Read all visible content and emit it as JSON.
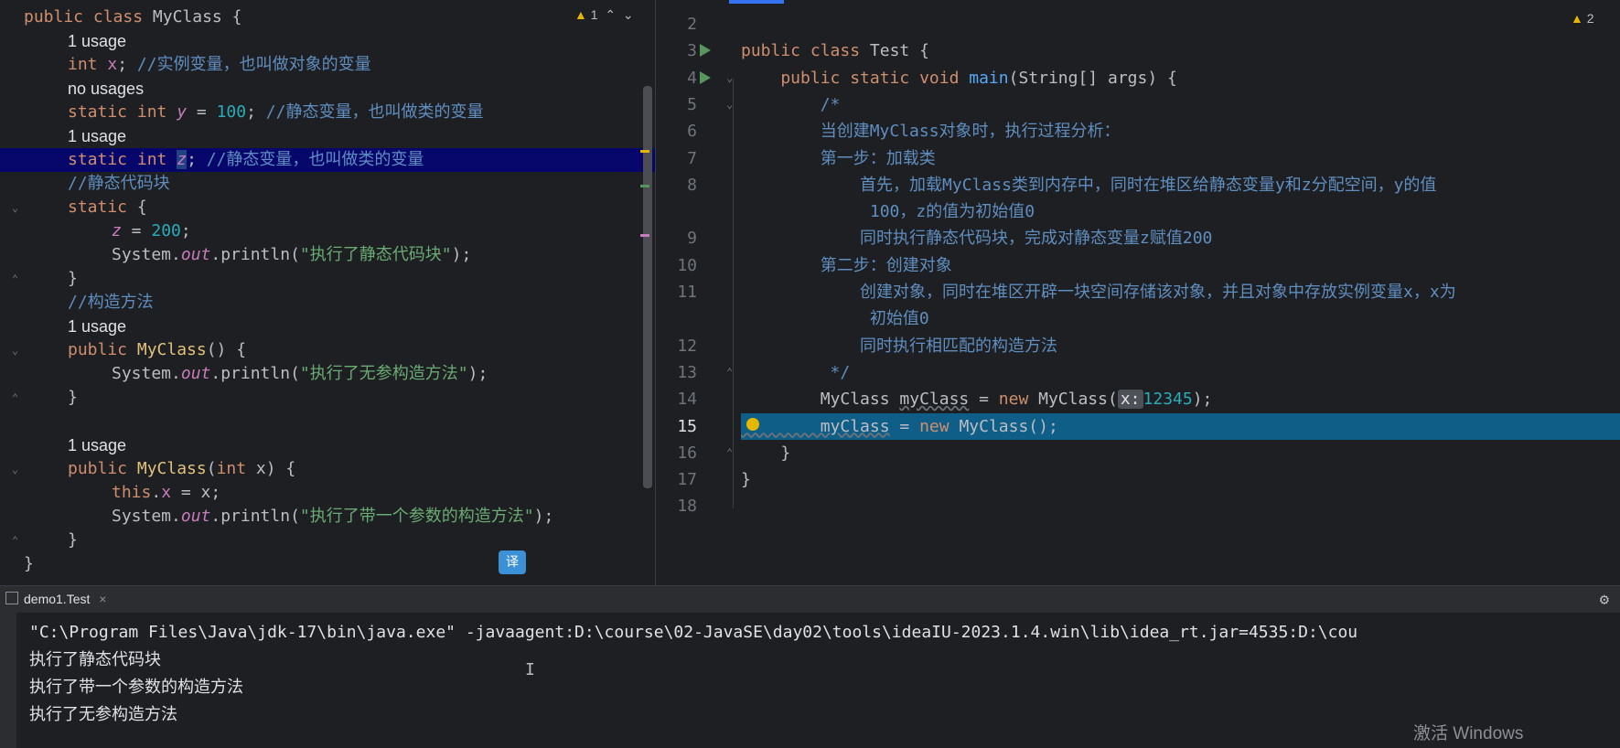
{
  "left_editor": {
    "inspection": {
      "count": "1"
    },
    "lines": [
      {
        "parts": [
          {
            "c": "kw",
            "t": "public class "
          },
          {
            "c": "plain",
            "t": "MyClass {"
          }
        ]
      },
      {
        "inlay": "1 usage"
      },
      {
        "parts": [
          {
            "c": "kw",
            "t": "int "
          },
          {
            "c": "field",
            "t": "x"
          },
          {
            "c": "plain",
            "t": "; "
          },
          {
            "c": "cmb",
            "t": "//实例变量，也叫做对象的变量"
          }
        ]
      },
      {
        "inlay": "no usages"
      },
      {
        "parts": [
          {
            "c": "kw",
            "t": "static int "
          },
          {
            "c": "sfield",
            "t": "y"
          },
          {
            "c": "plain",
            "t": " = "
          },
          {
            "c": "num",
            "t": "100"
          },
          {
            "c": "plain",
            "t": "; "
          },
          {
            "c": "cmb",
            "t": "//静态变量，也叫做类的变量"
          }
        ]
      },
      {
        "inlay": "1 usage"
      },
      {
        "parts": [
          {
            "c": "kw",
            "t": "static int "
          },
          {
            "c": "sfield sel",
            "t": "z"
          },
          {
            "c": "plain",
            "t": "; "
          },
          {
            "c": "cmb",
            "t": "//静态变量，也叫做类的变量"
          }
        ]
      },
      {
        "parts": [
          {
            "c": "cmb",
            "t": "//静态代码块"
          }
        ]
      },
      {
        "parts": [
          {
            "c": "kw",
            "t": "static "
          },
          {
            "c": "plain",
            "t": "{"
          }
        ]
      },
      {
        "parts": [
          {
            "c": "sfield",
            "t": "z"
          },
          {
            "c": "plain",
            "t": " = "
          },
          {
            "c": "num",
            "t": "200"
          },
          {
            "c": "plain",
            "t": ";"
          }
        ]
      },
      {
        "parts": [
          {
            "c": "plain",
            "t": "System."
          },
          {
            "c": "sfield",
            "t": "out"
          },
          {
            "c": "plain",
            "t": ".println("
          },
          {
            "c": "str",
            "t": "\"执行了静态代码块\""
          },
          {
            "c": "plain",
            "t": ");"
          }
        ]
      },
      {
        "parts": [
          {
            "c": "plain",
            "t": "}"
          }
        ]
      },
      {
        "parts": [
          {
            "c": "cmb",
            "t": "//构造方法"
          }
        ]
      },
      {
        "inlay": "1 usage"
      },
      {
        "parts": [
          {
            "c": "kw",
            "t": "public "
          },
          {
            "c": "ctor",
            "t": "MyClass"
          },
          {
            "c": "plain",
            "t": "() {"
          }
        ]
      },
      {
        "parts": [
          {
            "c": "plain",
            "t": "System."
          },
          {
            "c": "sfield",
            "t": "out"
          },
          {
            "c": "plain",
            "t": ".println("
          },
          {
            "c": "str",
            "t": "\"执行了无参构造方法\""
          },
          {
            "c": "plain",
            "t": ");"
          }
        ]
      },
      {
        "parts": [
          {
            "c": "plain",
            "t": "}"
          }
        ]
      },
      {
        "parts": []
      },
      {
        "inlay": "1 usage"
      },
      {
        "parts": [
          {
            "c": "kw",
            "t": "public "
          },
          {
            "c": "ctor",
            "t": "MyClass"
          },
          {
            "c": "plain",
            "t": "("
          },
          {
            "c": "kw",
            "t": "int "
          },
          {
            "c": "plain",
            "t": "x) {"
          }
        ]
      },
      {
        "parts": [
          {
            "c": "kw",
            "t": "this"
          },
          {
            "c": "plain",
            "t": "."
          },
          {
            "c": "field",
            "t": "x"
          },
          {
            "c": "plain",
            "t": " = x;"
          }
        ]
      },
      {
        "parts": [
          {
            "c": "plain",
            "t": "System."
          },
          {
            "c": "sfield",
            "t": "out"
          },
          {
            "c": "plain",
            "t": ".println("
          },
          {
            "c": "str",
            "t": "\"执行了带一个参数的构造方法\""
          },
          {
            "c": "plain",
            "t": ");"
          }
        ]
      },
      {
        "parts": [
          {
            "c": "plain",
            "t": "}"
          }
        ]
      },
      {
        "parts": [
          {
            "c": "plain",
            "t": "}"
          }
        ]
      }
    ],
    "translate_label": "译"
  },
  "right_editor": {
    "inspection": {
      "count": "2"
    },
    "lines": [
      {
        "n": "2",
        "parts": []
      },
      {
        "n": "3",
        "parts": [
          {
            "c": "kw",
            "t": "public class "
          },
          {
            "c": "plain",
            "t": "Test {"
          }
        ]
      },
      {
        "n": "4",
        "parts": [
          {
            "c": "kw",
            "t": "    public static void "
          },
          {
            "c": "fn",
            "t": "main"
          },
          {
            "c": "plain",
            "t": "(String[] args) {"
          }
        ]
      },
      {
        "n": "5",
        "parts": [
          {
            "c": "cmb",
            "t": "        /*"
          }
        ]
      },
      {
        "n": "6",
        "parts": [
          {
            "c": "cmb",
            "t": "        当创建MyClass对象时，执行过程分析："
          }
        ]
      },
      {
        "n": "7",
        "parts": [
          {
            "c": "cmb",
            "t": "        第一步：加载类"
          }
        ]
      },
      {
        "n": "8",
        "parts": [
          {
            "c": "cmb",
            "t": "            首先，加载MyClass类到内存中，同时在堆区给静态变量y和z分配空间，y的值"
          }
        ]
      },
      {
        "n": "",
        "parts": [
          {
            "c": "cmb",
            "t": "             100，z的值为初始值0"
          }
        ]
      },
      {
        "n": "9",
        "parts": [
          {
            "c": "cmb",
            "t": "            同时执行静态代码块，完成对静态变量z赋值200"
          }
        ]
      },
      {
        "n": "10",
        "parts": [
          {
            "c": "cmb",
            "t": "        第二步：创建对象"
          }
        ]
      },
      {
        "n": "11",
        "parts": [
          {
            "c": "cmb",
            "t": "            创建对象，同时在堆区开辟一块空间存储该对象，并且对象中存放实例变量x，x为"
          }
        ]
      },
      {
        "n": "",
        "parts": [
          {
            "c": "cmb",
            "t": "             初始值0"
          }
        ]
      },
      {
        "n": "12",
        "parts": [
          {
            "c": "cmb",
            "t": "            同时执行相匹配的构造方法"
          }
        ]
      },
      {
        "n": "13",
        "parts": [
          {
            "c": "cmb",
            "t": "         */"
          }
        ]
      },
      {
        "n": "14",
        "parts": [
          {
            "c": "plain",
            "t": "        MyClass "
          },
          {
            "c": "plain wavy",
            "t": "myClass"
          },
          {
            "c": "plain",
            "t": " = "
          },
          {
            "c": "kw",
            "t": "new "
          },
          {
            "c": "plain",
            "t": "MyClass("
          },
          {
            "c": "hint-box",
            "t": "x:"
          },
          {
            "c": "num",
            "t": "12345"
          },
          {
            "c": "plain",
            "t": ");"
          }
        ]
      },
      {
        "n": "15",
        "parts": [
          {
            "c": "plain wavy",
            "t": "        myClass"
          },
          {
            "c": "plain",
            "t": " = "
          },
          {
            "c": "kw",
            "t": "new "
          },
          {
            "c": "plain",
            "t": "MyClass();"
          }
        ]
      },
      {
        "n": "16",
        "parts": [
          {
            "c": "plain",
            "t": "    }"
          }
        ]
      },
      {
        "n": "17",
        "parts": [
          {
            "c": "plain",
            "t": "}"
          }
        ]
      },
      {
        "n": "18",
        "parts": []
      }
    ]
  },
  "run_panel": {
    "tab_label": "demo1.Test",
    "close_glyph": "×",
    "gear_glyph": "⚙",
    "output": [
      "\"C:\\Program Files\\Java\\jdk-17\\bin\\java.exe\" -javaagent:D:\\course\\02-JavaSE\\day02\\tools\\ideaIU-2023.1.4.win\\lib\\idea_rt.jar=4535:D:\\cou",
      "执行了静态代码块",
      "执行了带一个参数的构造方法",
      "执行了无参构造方法"
    ]
  },
  "watermark": "激活 Windows",
  "colors": {
    "highlight_left": "#07076b",
    "highlight_right": "#0f5e87",
    "keyword": "#cf8e6d",
    "comment": "#5f8ec0",
    "string": "#6aab73",
    "number": "#2aacb8"
  }
}
